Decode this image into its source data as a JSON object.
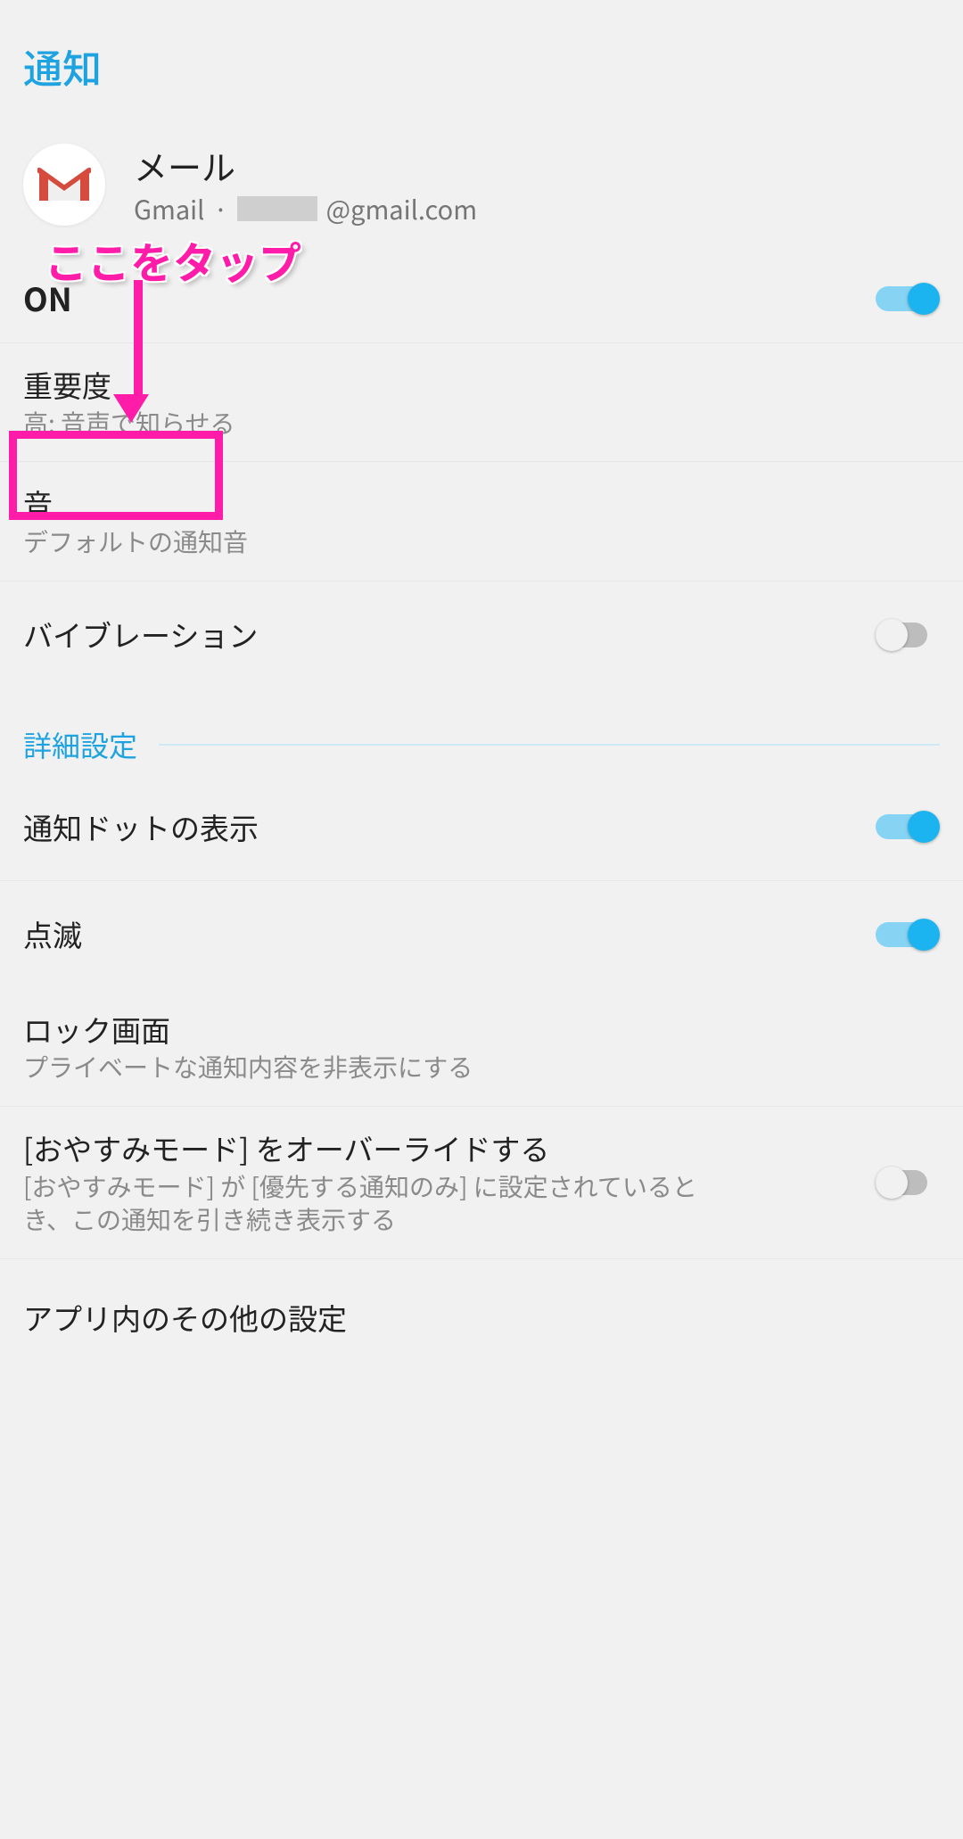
{
  "pageTitle": "通知",
  "app": {
    "name": "メール",
    "service": "Gmail",
    "emailSuffix": "@gmail.com"
  },
  "rows": {
    "on": {
      "label": "ON"
    },
    "importance": {
      "title": "重要度",
      "sub": "高: 音声で知らせる"
    },
    "sound": {
      "title": "音",
      "sub": "デフォルトの通知音"
    },
    "vibration": {
      "title": "バイブレーション"
    },
    "advanced": {
      "label": "詳細設定"
    },
    "dot": {
      "title": "通知ドットの表示"
    },
    "blink": {
      "title": "点滅"
    },
    "lock": {
      "title": "ロック画面",
      "sub": "プライベートな通知内容を非表示にする"
    },
    "dnd": {
      "title": "[おやすみモード] をオーバーライドする",
      "sub": "[おやすみモード] が [優先する通知のみ] に設定されているとき、この通知を引き続き表示する"
    },
    "inapp": {
      "title": "アプリ内のその他の設定"
    }
  },
  "annotation": {
    "text": "ここをタップ"
  }
}
